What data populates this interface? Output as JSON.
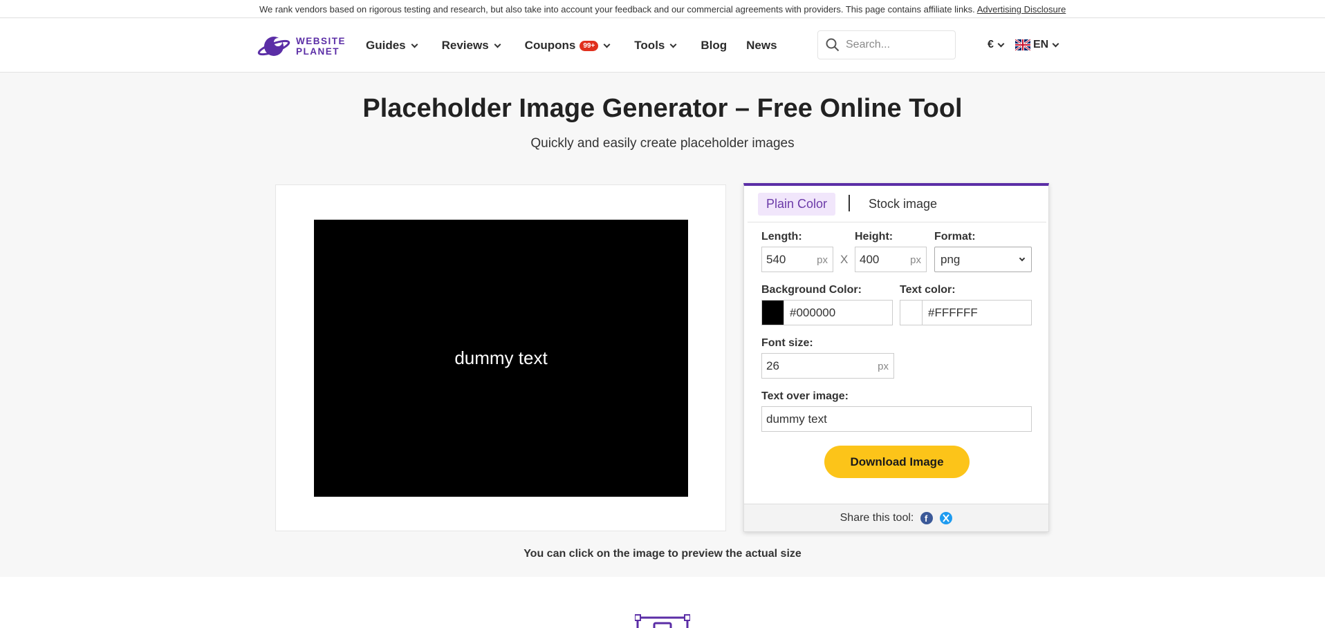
{
  "disclosure": {
    "text": "We rank vendors based on rigorous testing and research, but also take into account your feedback and our commercial agreements with providers. This page contains affiliate links.",
    "link": "Advertising Disclosure"
  },
  "header": {
    "logo_line1": "WEBSITE",
    "logo_line2": "PLANET",
    "nav": [
      {
        "label": "Guides",
        "dropdown": true
      },
      {
        "label": "Reviews",
        "dropdown": true
      },
      {
        "label": "Coupons",
        "badge": "99+",
        "dropdown": true
      },
      {
        "label": "Tools",
        "dropdown": true
      },
      {
        "label": "Blog",
        "dropdown": false
      },
      {
        "label": "News",
        "dropdown": false
      }
    ],
    "search_placeholder": "Search...",
    "currency": "€",
    "language": "EN"
  },
  "hero": {
    "title": "Placeholder Image Generator – Free Online Tool",
    "subtitle": "Quickly and easily create placeholder images"
  },
  "preview": {
    "text": "dummy text",
    "background": "#000000",
    "text_color": "#FFFFFF"
  },
  "tool": {
    "tabs": {
      "plain": "Plain Color",
      "stock": "Stock image"
    },
    "length_label": "Length:",
    "length_value": "540",
    "height_label": "Height:",
    "height_value": "400",
    "unit": "px",
    "times": "X",
    "format_label": "Format:",
    "format_value": "png",
    "bg_label": "Background Color:",
    "bg_value": "#000000",
    "text_color_label": "Text color:",
    "text_color_value": "#FFFFFF",
    "font_size_label": "Font size:",
    "font_size_value": "26",
    "text_over_label": "Text over image:",
    "text_over_value": "dummy text",
    "download_label": "Download Image",
    "share_label": "Share this tool:"
  },
  "hint": "You can click on the image to preview the actual size",
  "colors": {
    "brand": "#5b2ea6",
    "tab_active_bg": "#f1e6fb",
    "download": "#fcc419",
    "badge": "#e0301e",
    "facebook": "#3b5998",
    "x_blue": "#1d9bf0"
  }
}
